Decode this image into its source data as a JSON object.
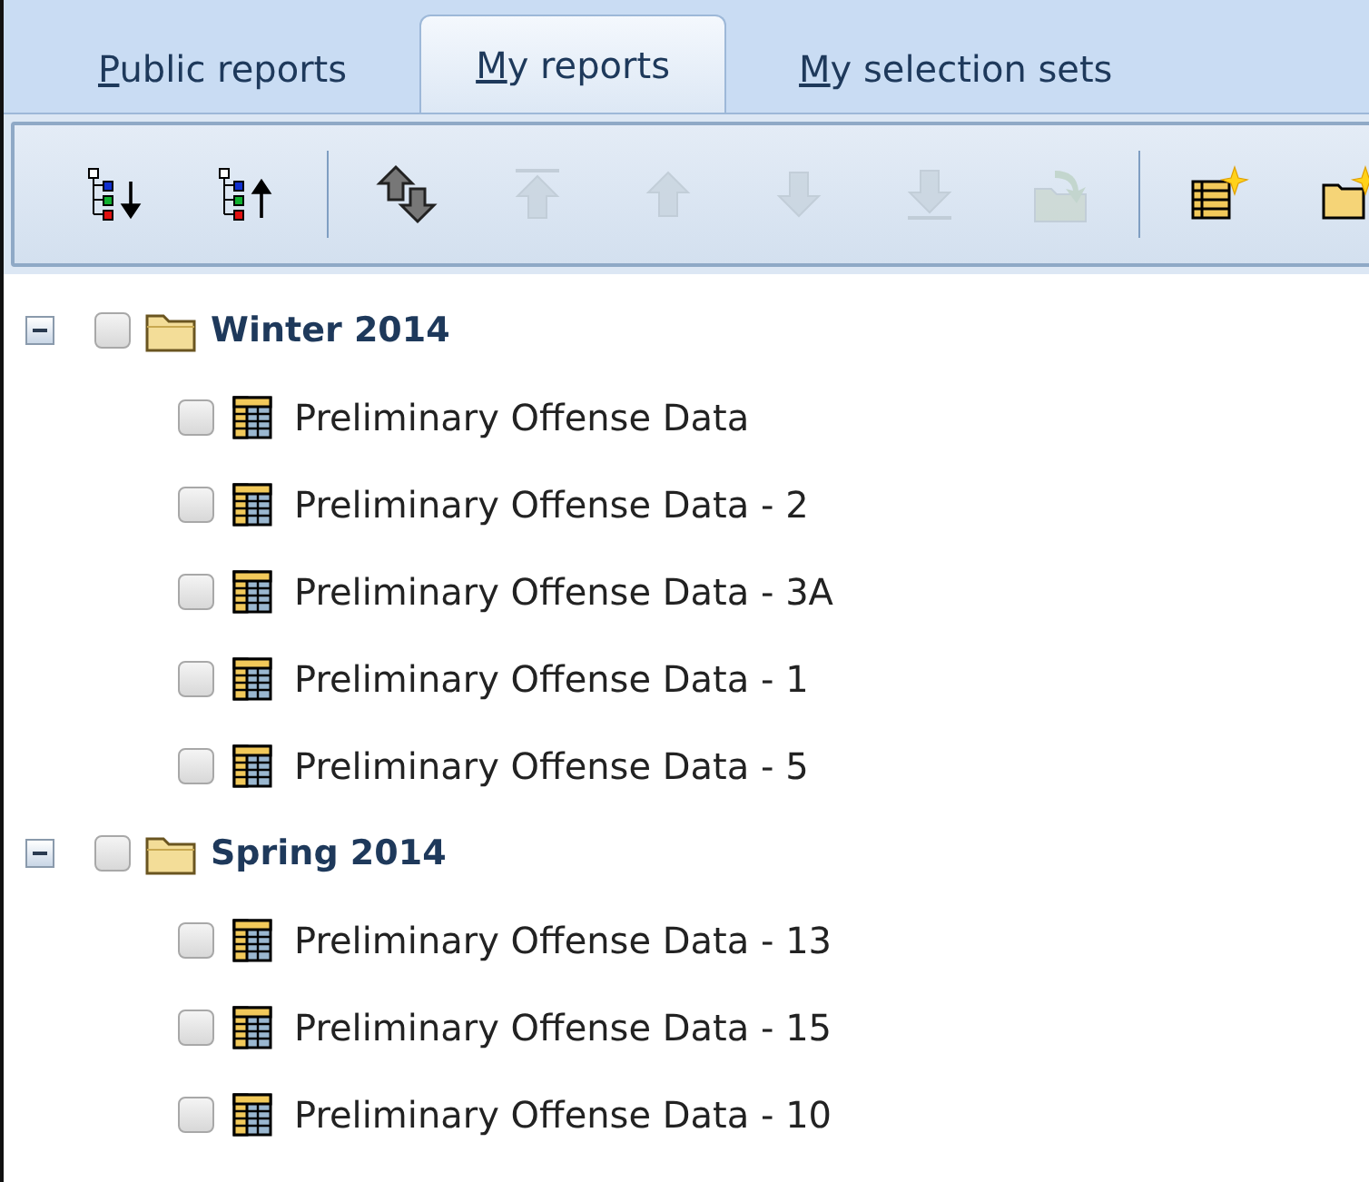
{
  "tabs": [
    {
      "label": "Public reports",
      "mnemonic_underlined": true,
      "selected": false
    },
    {
      "label": "My reports",
      "mnemonic_underlined": true,
      "selected": true
    },
    {
      "label": "My selection sets",
      "mnemonic_underlined": true,
      "selected": false
    }
  ],
  "toolbar": [
    {
      "kind": "expand-all",
      "disabled": false
    },
    {
      "kind": "collapse-all",
      "disabled": false
    },
    {
      "kind": "separator"
    },
    {
      "kind": "swap",
      "disabled": false
    },
    {
      "kind": "move-top",
      "disabled": true
    },
    {
      "kind": "move-up",
      "disabled": true
    },
    {
      "kind": "move-down",
      "disabled": true
    },
    {
      "kind": "move-bottom",
      "disabled": true
    },
    {
      "kind": "move-to-folder",
      "disabled": true
    },
    {
      "kind": "separator"
    },
    {
      "kind": "new-report",
      "disabled": false
    },
    {
      "kind": "new-folder",
      "disabled": false
    }
  ],
  "tree": [
    {
      "label": "Winter 2014",
      "expanded": true,
      "checked": false,
      "children": [
        {
          "label": "Preliminary Offense Data",
          "checked": false
        },
        {
          "label": "Preliminary Offense Data - 2",
          "checked": false
        },
        {
          "label": "Preliminary Offense Data - 3A",
          "checked": false
        },
        {
          "label": "Preliminary Offense Data - 1",
          "checked": false
        },
        {
          "label": "Preliminary Offense Data - 5",
          "checked": false
        }
      ]
    },
    {
      "label": "Spring 2014",
      "expanded": true,
      "checked": false,
      "children": [
        {
          "label": "Preliminary Offense Data - 13",
          "checked": false
        },
        {
          "label": "Preliminary Offense Data - 15",
          "checked": false
        },
        {
          "label": "Preliminary Offense Data - 10",
          "checked": false
        }
      ]
    }
  ]
}
